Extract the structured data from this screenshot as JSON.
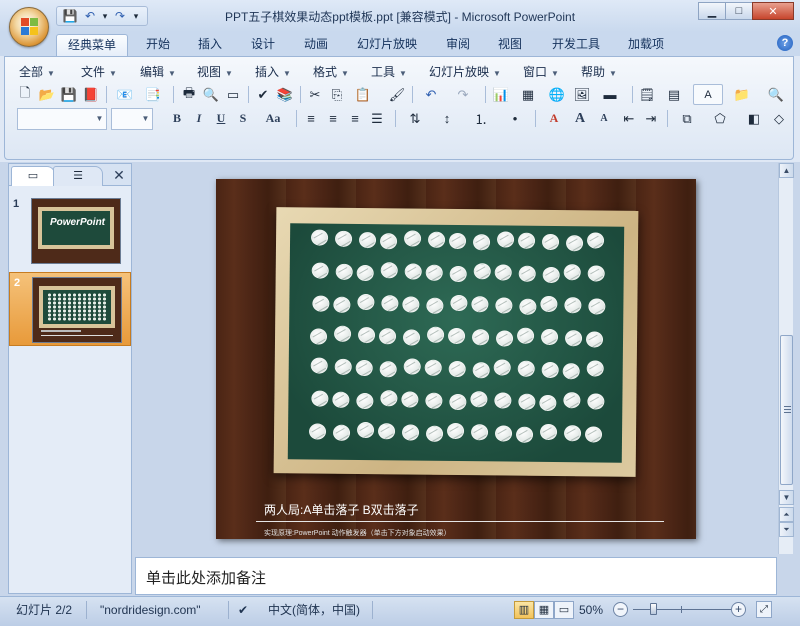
{
  "window": {
    "title": "PPT五子棋效果动态ppt模板.ppt [兼容模式] - Microsoft PowerPoint",
    "minimize": "▁",
    "maximize": "□",
    "close": "✕"
  },
  "qat": {
    "save": "💾",
    "undo": "↶",
    "undo_arrow": "▾",
    "redo": "↷",
    "customize": "▾"
  },
  "ribbon_tabs": [
    "经典菜单",
    "开始",
    "插入",
    "设计",
    "动画",
    "幻灯片放映",
    "审阅",
    "视图",
    "开发工具",
    "加载项"
  ],
  "active_tab": "经典菜单",
  "help": "?",
  "menus": [
    "全部",
    "文件",
    "编辑",
    "视图",
    "插入",
    "格式",
    "工具",
    "幻灯片放映",
    "窗口",
    "帮助"
  ],
  "format_buttons": {
    "bold": "B",
    "italic": "I",
    "underline": "U",
    "shadow": "S",
    "case": "Aa",
    "font_color": "A",
    "grow": "A",
    "shrink": "A"
  },
  "left_pane": {
    "close": "✕"
  },
  "thumbnails": [
    {
      "number": "1",
      "logo": "PowerPoint"
    },
    {
      "number": "2"
    }
  ],
  "slide": {
    "caption": "两人局:A单击落子  B双击落子",
    "small_text": "实现原理:PowerPoint 动作触发器（单击下方对象启动效果）"
  },
  "notes": {
    "placeholder": "单击此处添加备注"
  },
  "status": {
    "slide": "幻灯片 2/2",
    "theme": "\"nordridesign.com\"",
    "language": "中文(简体，中国)",
    "zoom": "50%",
    "zoom_level": 0.5,
    "zoom_out": "−",
    "zoom_in": "+"
  },
  "colors": {
    "board": "#1c4a3b",
    "wood": "#4a2414",
    "frame": "#d8c49a",
    "selected_thumb": "#e89a3a"
  }
}
